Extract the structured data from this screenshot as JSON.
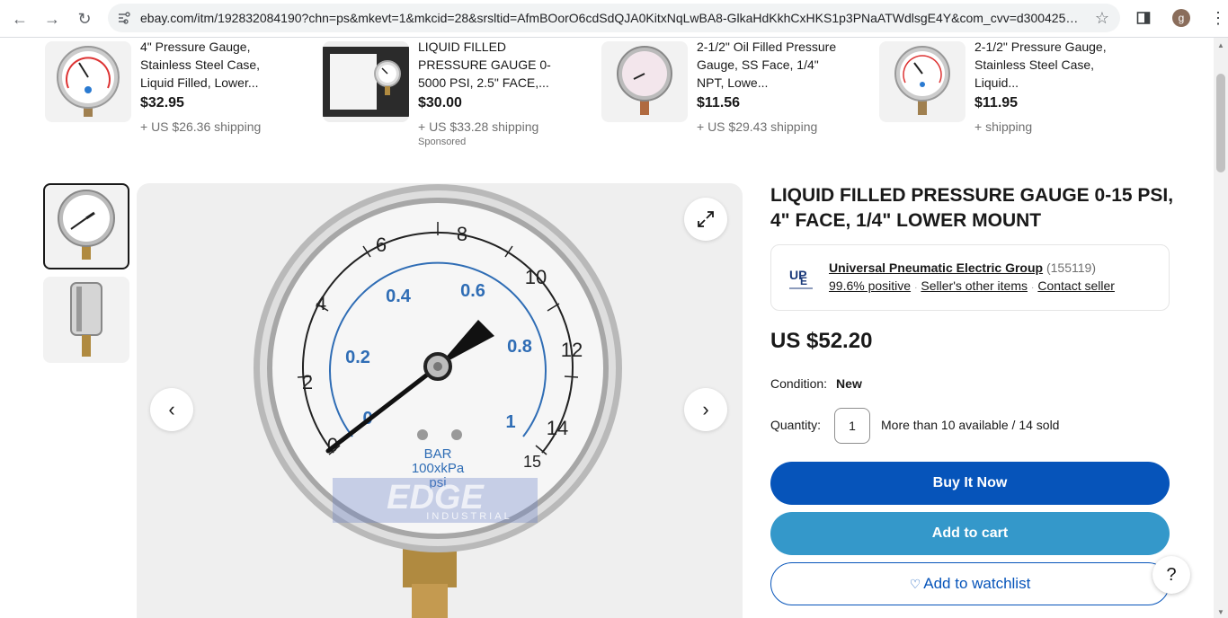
{
  "browser": {
    "url": "ebay.com/itm/192832084190?chn=ps&mkevt=1&mkcid=28&srsltid=AfmBOorO6cdSdQJA0KitxNqLwBA8-GlkaHdKkhCxHKS1p3PNaATWdlsgE4Y&com_cvv=d30042528f...",
    "profile_initial": "g"
  },
  "similar_items": [
    {
      "title": "4\" Pressure Gauge, Stainless Steel Case, Liquid Filled, Lower...",
      "price": "$32.95",
      "shipping": "+ US $26.36 shipping",
      "sponsored": ""
    },
    {
      "title": "LIQUID FILLED PRESSURE GAUGE 0-5000 PSI, 2.5\" FACE,...",
      "price": "$30.00",
      "shipping": "+ US $33.28 shipping",
      "sponsored": "Sponsored"
    },
    {
      "title": "2-1/2\" Oil Filled Pressure Gauge, SS Face, 1/4\" NPT, Lowe...",
      "price": "$11.56",
      "shipping": "+ US $29.43 shipping",
      "sponsored": ""
    },
    {
      "title": "2-1/2\" Pressure Gauge, Stainless Steel Case, Liquid...",
      "price": "$11.95",
      "shipping": "+ shipping",
      "sponsored": ""
    }
  ],
  "gauge": {
    "psi_labels": [
      "0",
      "2",
      "4",
      "6",
      "8",
      "10",
      "12",
      "14",
      "15"
    ],
    "bar_labels": [
      "0",
      "0.2",
      "0.4",
      "0.6",
      "0.8",
      "1"
    ],
    "unit_bar": "BAR",
    "unit_kpa": "100xkPa",
    "unit_psi": "psi",
    "watermark": "EDGE",
    "watermark_sub": "INDUSTRIAL"
  },
  "product": {
    "title": "LIQUID FILLED PRESSURE GAUGE 0-15 PSI, 4\" FACE, 1/4\" LOWER MOUNT",
    "seller_name": "Universal Pneumatic Electric Group",
    "seller_count": "(155119)",
    "seller_positive": "99.6% positive",
    "seller_other": "Seller's other items",
    "seller_contact": "Contact seller",
    "price": "US $52.20",
    "condition_label": "Condition:",
    "condition_value": "New",
    "quantity_label": "Quantity:",
    "quantity_value": "1",
    "availability": "More than 10 available / 14 sold"
  },
  "actions": {
    "buy_now": "Buy It Now",
    "add_to_cart": "Add to cart",
    "watchlist": "Add to watchlist"
  },
  "help": "?",
  "colors": {
    "buy_now": "#0654ba",
    "add_to_cart": "#3498ca",
    "gauge_blue": "#2f6db5"
  }
}
